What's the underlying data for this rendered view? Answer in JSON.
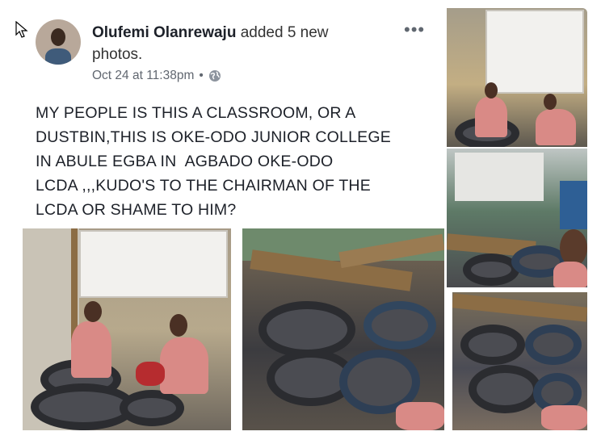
{
  "post": {
    "author": "Olufemi Olanrewaju",
    "action": "added 5 new photos.",
    "timestamp": "Oct 24 at 11:38pm",
    "separator": "•",
    "privacy_icon": "globe-icon",
    "more_label": "•••",
    "text": "MY PEOPLE IS THIS A CLASSROOM, OR A\nDUSTBIN,THIS IS OKE-ODO JUNIOR COLLEGE\nIN ABULE EGBA IN  AGBADO OKE-ODO\nLCDA ,,,KUDO'S TO THE CHAIRMAN OF THE\nLCDA OR SHAME TO HIM?"
  },
  "photos": [
    {
      "id": "photo-1",
      "alt_icon": "image"
    },
    {
      "id": "photo-2",
      "alt_icon": "image"
    },
    {
      "id": "photo-3",
      "alt_icon": "image"
    },
    {
      "id": "photo-4",
      "alt_icon": "image"
    },
    {
      "id": "photo-5",
      "alt_icon": "image"
    }
  ]
}
